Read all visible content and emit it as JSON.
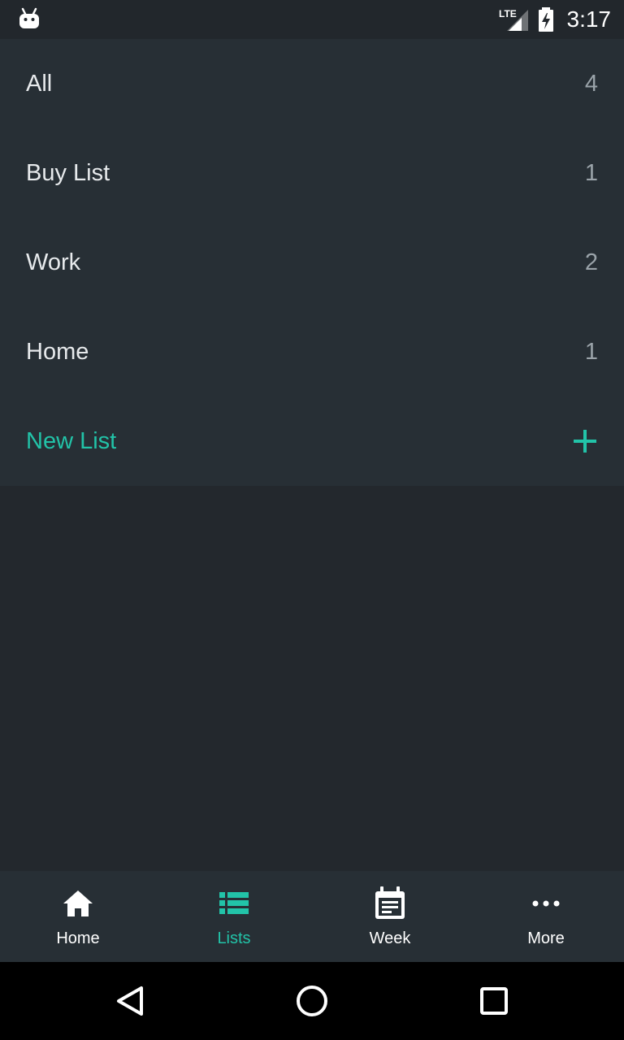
{
  "status_bar": {
    "network": "LTE",
    "time": "3:17",
    "icons": [
      "android-robot-icon",
      "lte-signal-icon",
      "battery-charging-icon"
    ]
  },
  "lists": [
    {
      "label": "All",
      "count": "4"
    },
    {
      "label": "Buy List",
      "count": "1"
    },
    {
      "label": "Work",
      "count": "2"
    },
    {
      "label": "Home",
      "count": "1"
    }
  ],
  "new_list": {
    "label": "New List",
    "icon": "plus-icon"
  },
  "bottom_nav": {
    "items": [
      {
        "label": "Home",
        "icon": "home-icon",
        "active": false
      },
      {
        "label": "Lists",
        "icon": "list-icon",
        "active": true
      },
      {
        "label": "Week",
        "icon": "calendar-icon",
        "active": false
      },
      {
        "label": "More",
        "icon": "more-dots-icon",
        "active": false
      }
    ]
  },
  "colors": {
    "accent": "#22c3a8",
    "panel": "#272f35",
    "background": "#23282d",
    "text_primary": "#e7eaec",
    "text_secondary": "#9aa3a9"
  },
  "system_nav": {
    "icons": [
      "back-icon",
      "home-circle-icon",
      "recents-icon"
    ]
  }
}
